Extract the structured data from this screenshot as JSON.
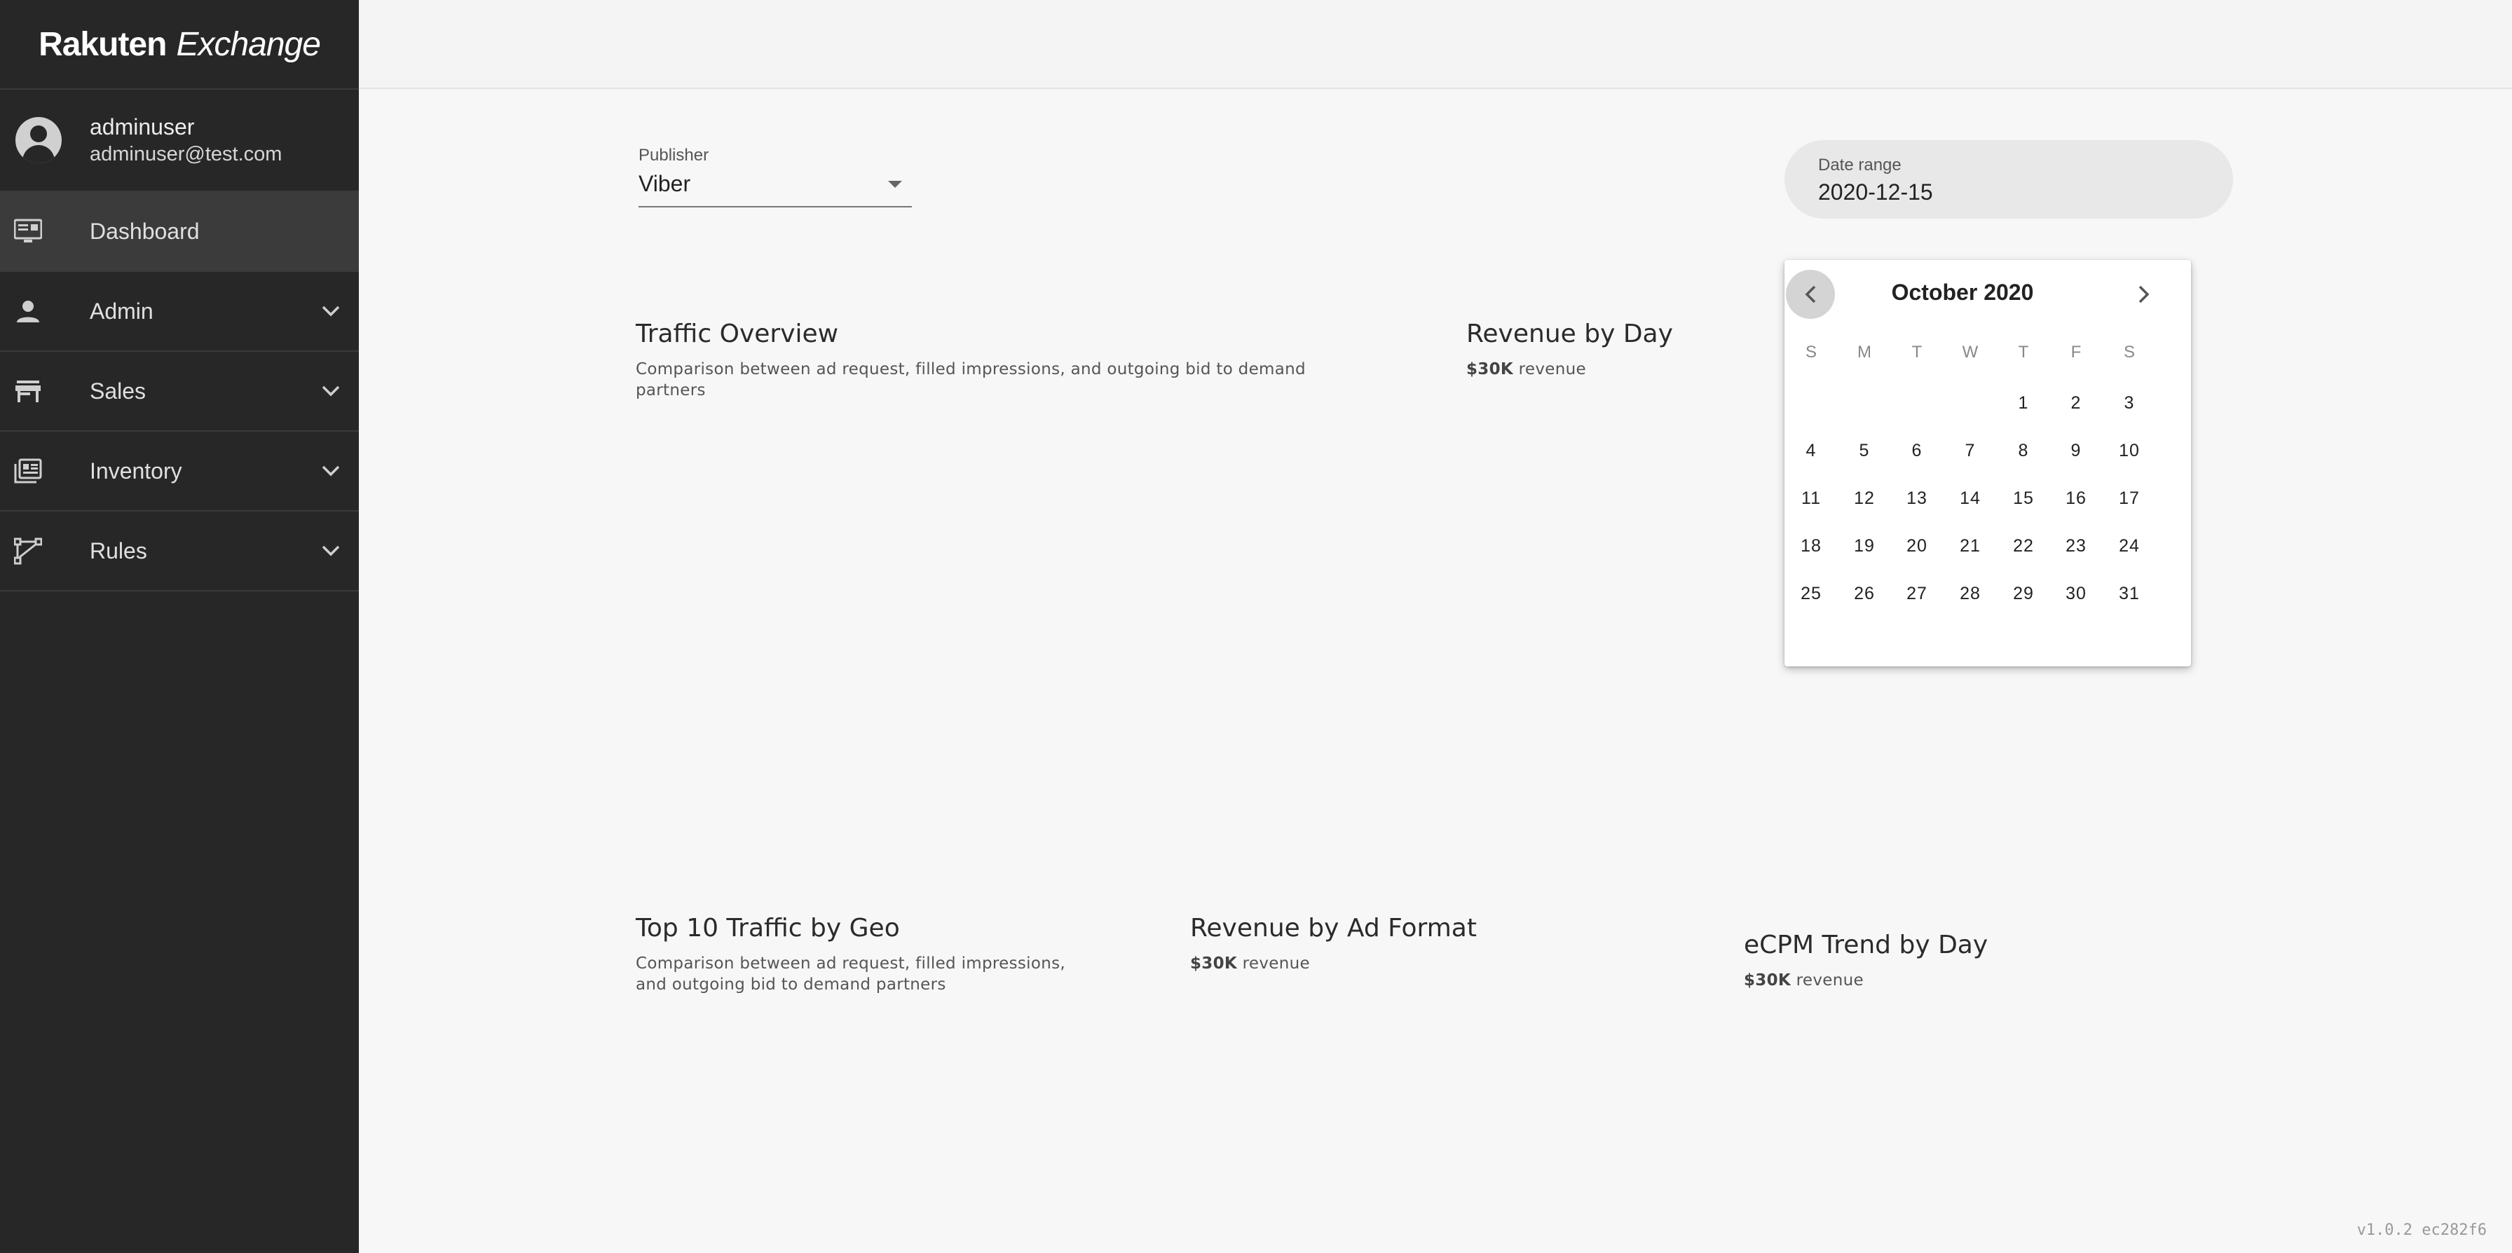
{
  "app": {
    "logo_primary": "Rakuten",
    "logo_secondary": "Exchange"
  },
  "user": {
    "name": "adminuser",
    "email": "adminuser@test.com"
  },
  "nav": {
    "items": [
      {
        "label": "Dashboard",
        "icon": "monitor-icon"
      },
      {
        "label": "Admin",
        "icon": "person-icon"
      },
      {
        "label": "Sales",
        "icon": "store-icon"
      },
      {
        "label": "Inventory",
        "icon": "inventory-icon"
      },
      {
        "label": "Rules",
        "icon": "branch-icon"
      }
    ]
  },
  "filters": {
    "publisher_label": "Publisher",
    "publisher_value": "Viber",
    "date_label": "Date range",
    "date_value": "2020-12-15"
  },
  "cards": {
    "traffic_overview": {
      "title": "Traffic Overview",
      "subtitle": "Comparison between ad request, filled impressions, and outgoing bid to demand partners"
    },
    "revenue_by_day": {
      "title": "Revenue by Day",
      "amount": "$30K",
      "suffix": "revenue"
    },
    "top_geo": {
      "title": "Top 10 Traffic by Geo",
      "subtitle_line1": "Comparison between ad request, filled impressions,",
      "subtitle_line2": "and outgoing bid to demand partners"
    },
    "revenue_ad_format": {
      "title": "Revenue by Ad Format",
      "amount": "$30K",
      "suffix": "revenue"
    },
    "ecpm_trend": {
      "title": "eCPM Trend by Day",
      "amount": "$30K",
      "suffix": "revenue"
    }
  },
  "calendar": {
    "month_label": "October 2020",
    "weekdays": [
      "S",
      "M",
      "T",
      "W",
      "T",
      "F",
      "S"
    ],
    "first_weekday": 4,
    "days_in_month": 31
  },
  "footer": {
    "version": "v1.0.2 ec282f6"
  }
}
